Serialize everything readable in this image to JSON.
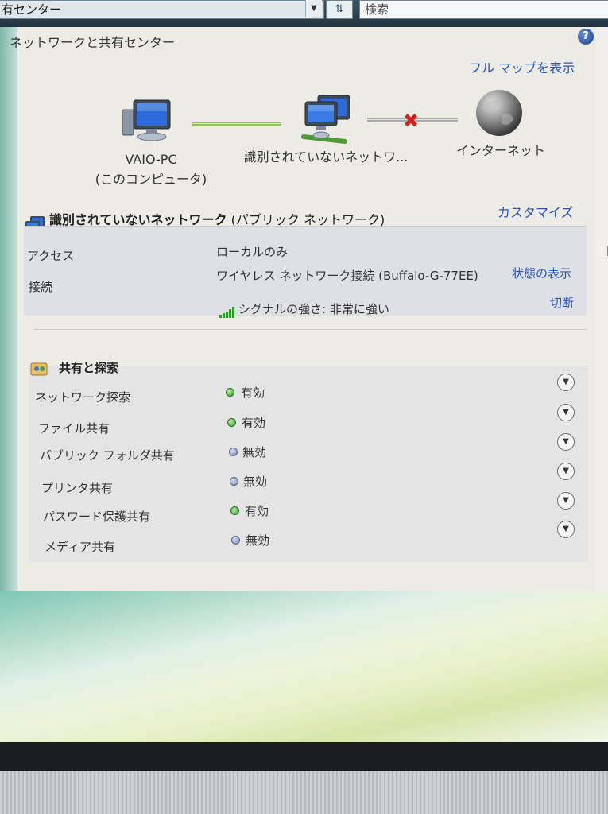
{
  "window": {
    "address_text": "有センター",
    "search_placeholder": "検索",
    "help_label": "?",
    "title": "ネットワークと共有センター",
    "full_map_link": "フル マップを表示"
  },
  "network_map": {
    "computer_name": "VAIO-PC",
    "computer_sub": "(このコンピュータ)",
    "network_name": "識別されていないネットワ...",
    "internet_label": "インターネット"
  },
  "network_details": {
    "heading_bold": "識別されていないネットワーク",
    "heading_type": " (パブリック ネットワーク)",
    "customize_link": "カスタマイズ",
    "access_label": "アクセス",
    "access_value": "ローカルのみ",
    "connection_label": "接続",
    "connection_value": "ワイヤレス ネットワーク接続 (Buffalo-G-77EE)",
    "view_status_link": "状態の表示",
    "signal_value": "シグナルの強さ: 非常に強い",
    "disconnect_link": "切断"
  },
  "sharing": {
    "heading": "共有と探索",
    "items": [
      {
        "label": "ネットワーク探索",
        "status": "有効",
        "enabled": true
      },
      {
        "label": "ファイル共有",
        "status": "有効",
        "enabled": true
      },
      {
        "label": "パブリック フォルダ共有",
        "status": "無効",
        "enabled": false
      },
      {
        "label": "プリンタ共有",
        "status": "無効",
        "enabled": false
      },
      {
        "label": "パスワード保護共有",
        "status": "有効",
        "enabled": true
      },
      {
        "label": "メディア共有",
        "status": "無効",
        "enabled": false
      }
    ]
  },
  "colors": {
    "link": "#2a56b6",
    "enabled_dot": "#2f9a2a",
    "disabled_dot": "#7786ab",
    "broken_link_x": "#d2201c"
  }
}
